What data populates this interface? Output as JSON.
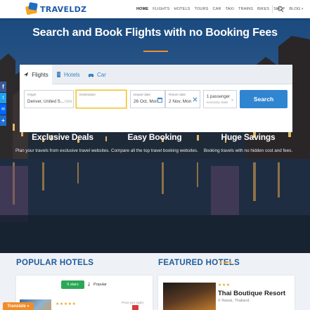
{
  "brand": {
    "name": "TRAVELDZ"
  },
  "nav": {
    "items": [
      "HOME",
      "FLIGHTS",
      "HOTELS",
      "TOURS",
      "CAR",
      "TAXI",
      "TRAINS",
      "BIKES",
      "SHOP",
      "BLOG"
    ],
    "active": "HOME"
  },
  "hero": {
    "title": "Search and Book Flights with no Booking Fees",
    "tabs": [
      {
        "label": "Flights",
        "icon": "plane-icon"
      },
      {
        "label": "Hotels",
        "icon": "building-icon"
      },
      {
        "label": "Car",
        "icon": "car-icon"
      }
    ],
    "form": {
      "origin_label": "Origin",
      "origin_value": "Denver, United S...",
      "origin_code": "DEN",
      "destination_label": "Destination",
      "destination_value": "",
      "depart_label": "Depart date",
      "depart_value": "26 Oct, Mon",
      "return_label": "Return date",
      "return_value": "2 Nov, Mon",
      "passengers_value": "1 passenger",
      "class_value": "economy class",
      "search_label": "Search"
    },
    "features": [
      {
        "title": "Exclusive Deals",
        "text": "Plan your travels from exclusive travel websites."
      },
      {
        "title": "Easy Booking",
        "text": "Compare all the top travel booking websites."
      },
      {
        "title": "Huge Savings",
        "text": "Booking travels with no hidden cost and fees."
      }
    ]
  },
  "social": [
    "facebook-icon",
    "twitter-icon",
    "email-icon",
    "share-icon"
  ],
  "popular": {
    "title": "POPULAR HOTELS",
    "filter_stars": "5 stars",
    "filter_popular": "Popular",
    "item_stars": "★★★★★",
    "price_label": "Price per night"
  },
  "featured": {
    "title": "FEATURED HOTELS",
    "title_stars": "★★★",
    "hotel_stars": "★★★",
    "hotel_name": "Thai Boutique Resort",
    "hotel_location": "Rawai, Thailand"
  },
  "translate_label": "Translate »",
  "colors": {
    "accent": "#2f85d0",
    "orange": "#f28c28",
    "heading": "#1e5c9c",
    "green": "#2aa855"
  }
}
